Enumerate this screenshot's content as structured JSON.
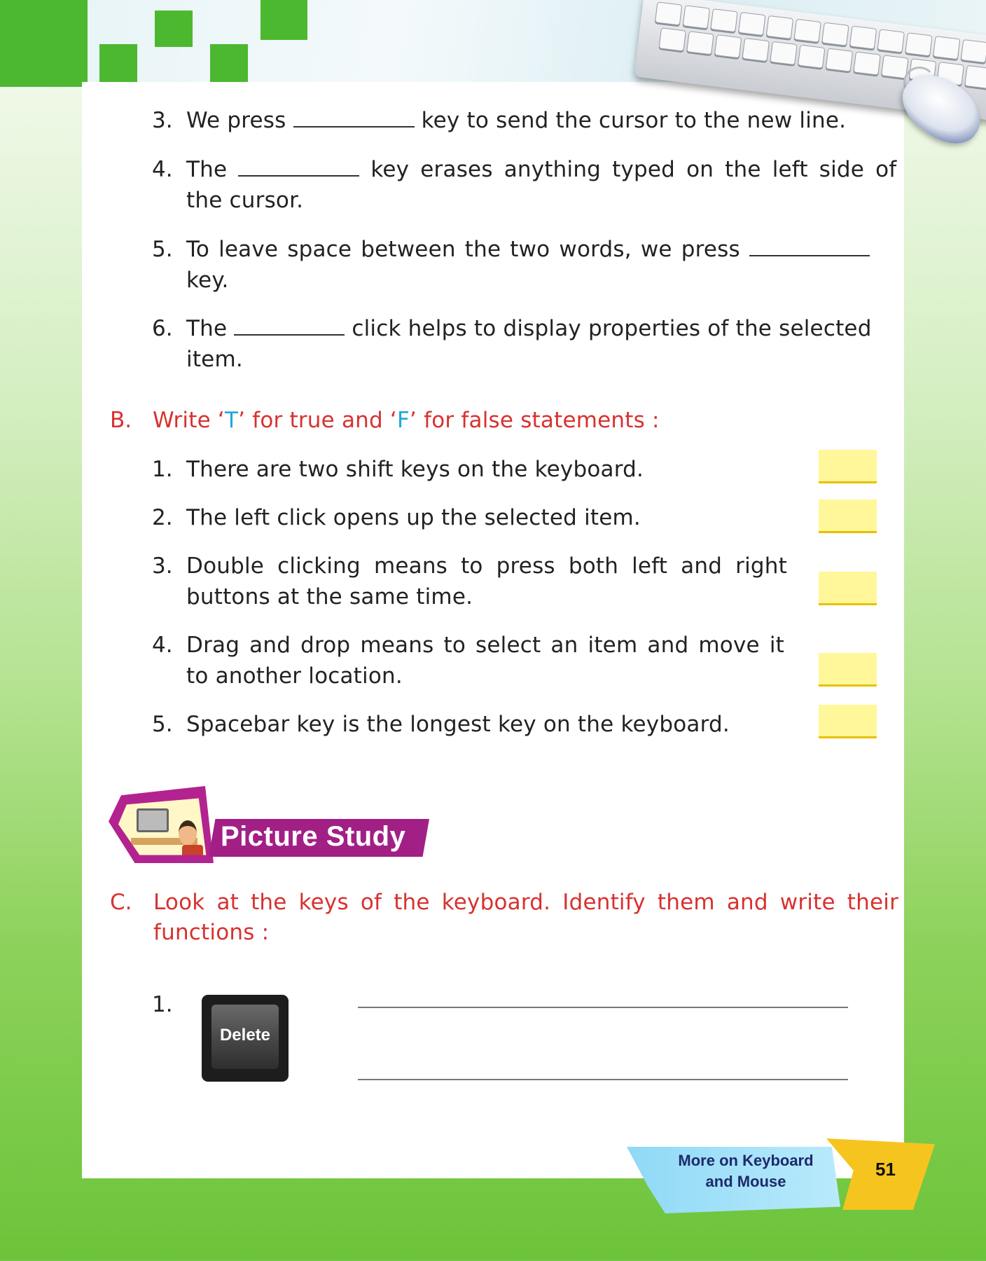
{
  "section_a_items": [
    {
      "number": "3.",
      "before": "We press ",
      "after": " key to send the cursor to the new line."
    },
    {
      "number": "4.",
      "before": "The ",
      "after": " key erases anything typed on the left side of",
      "cont": "the cursor."
    },
    {
      "number": "5.",
      "before": "To leave space between the two words, we press ",
      "after": "",
      "cont": "key."
    },
    {
      "number": "6.",
      "before": "The ",
      "after": " click helps to display properties of the selected",
      "cont": "item."
    }
  ],
  "section_b": {
    "letter": "B.",
    "heading_part1": "Write ‘",
    "heading_t": "T",
    "heading_part2": "’ for true and ‘",
    "heading_f": "F",
    "heading_part3": "’ for false statements :",
    "items": [
      {
        "number": "1.",
        "line1": "There are two shift keys on the keyboard."
      },
      {
        "number": "2.",
        "line1": "The left click opens up the selected item."
      },
      {
        "number": "3.",
        "line1": "Double clicking means to press both left and right",
        "line2": "buttons at the same time."
      },
      {
        "number": "4.",
        "line1": "Drag and drop means to select an item and move it",
        "line2": "to another location."
      },
      {
        "number": "5.",
        "line1": "Spacebar key is the longest key on the keyboard."
      }
    ]
  },
  "picture_study": {
    "title": "Picture  Study"
  },
  "section_c": {
    "letter": "C.",
    "line1": "Look at the keys of the keyboard. Identify them and write their",
    "line2": "functions :",
    "item_number": "1.",
    "key_label": "Delete"
  },
  "footer": {
    "chapter_line1": "More on Keyboard",
    "chapter_line2": "and Mouse",
    "page_number": "51"
  },
  "colors": {
    "heading_red": "#d8312f",
    "tf_blue": "#1fa8dd",
    "answer_box": "#fff79a",
    "brand_green": "#4cb82f"
  }
}
